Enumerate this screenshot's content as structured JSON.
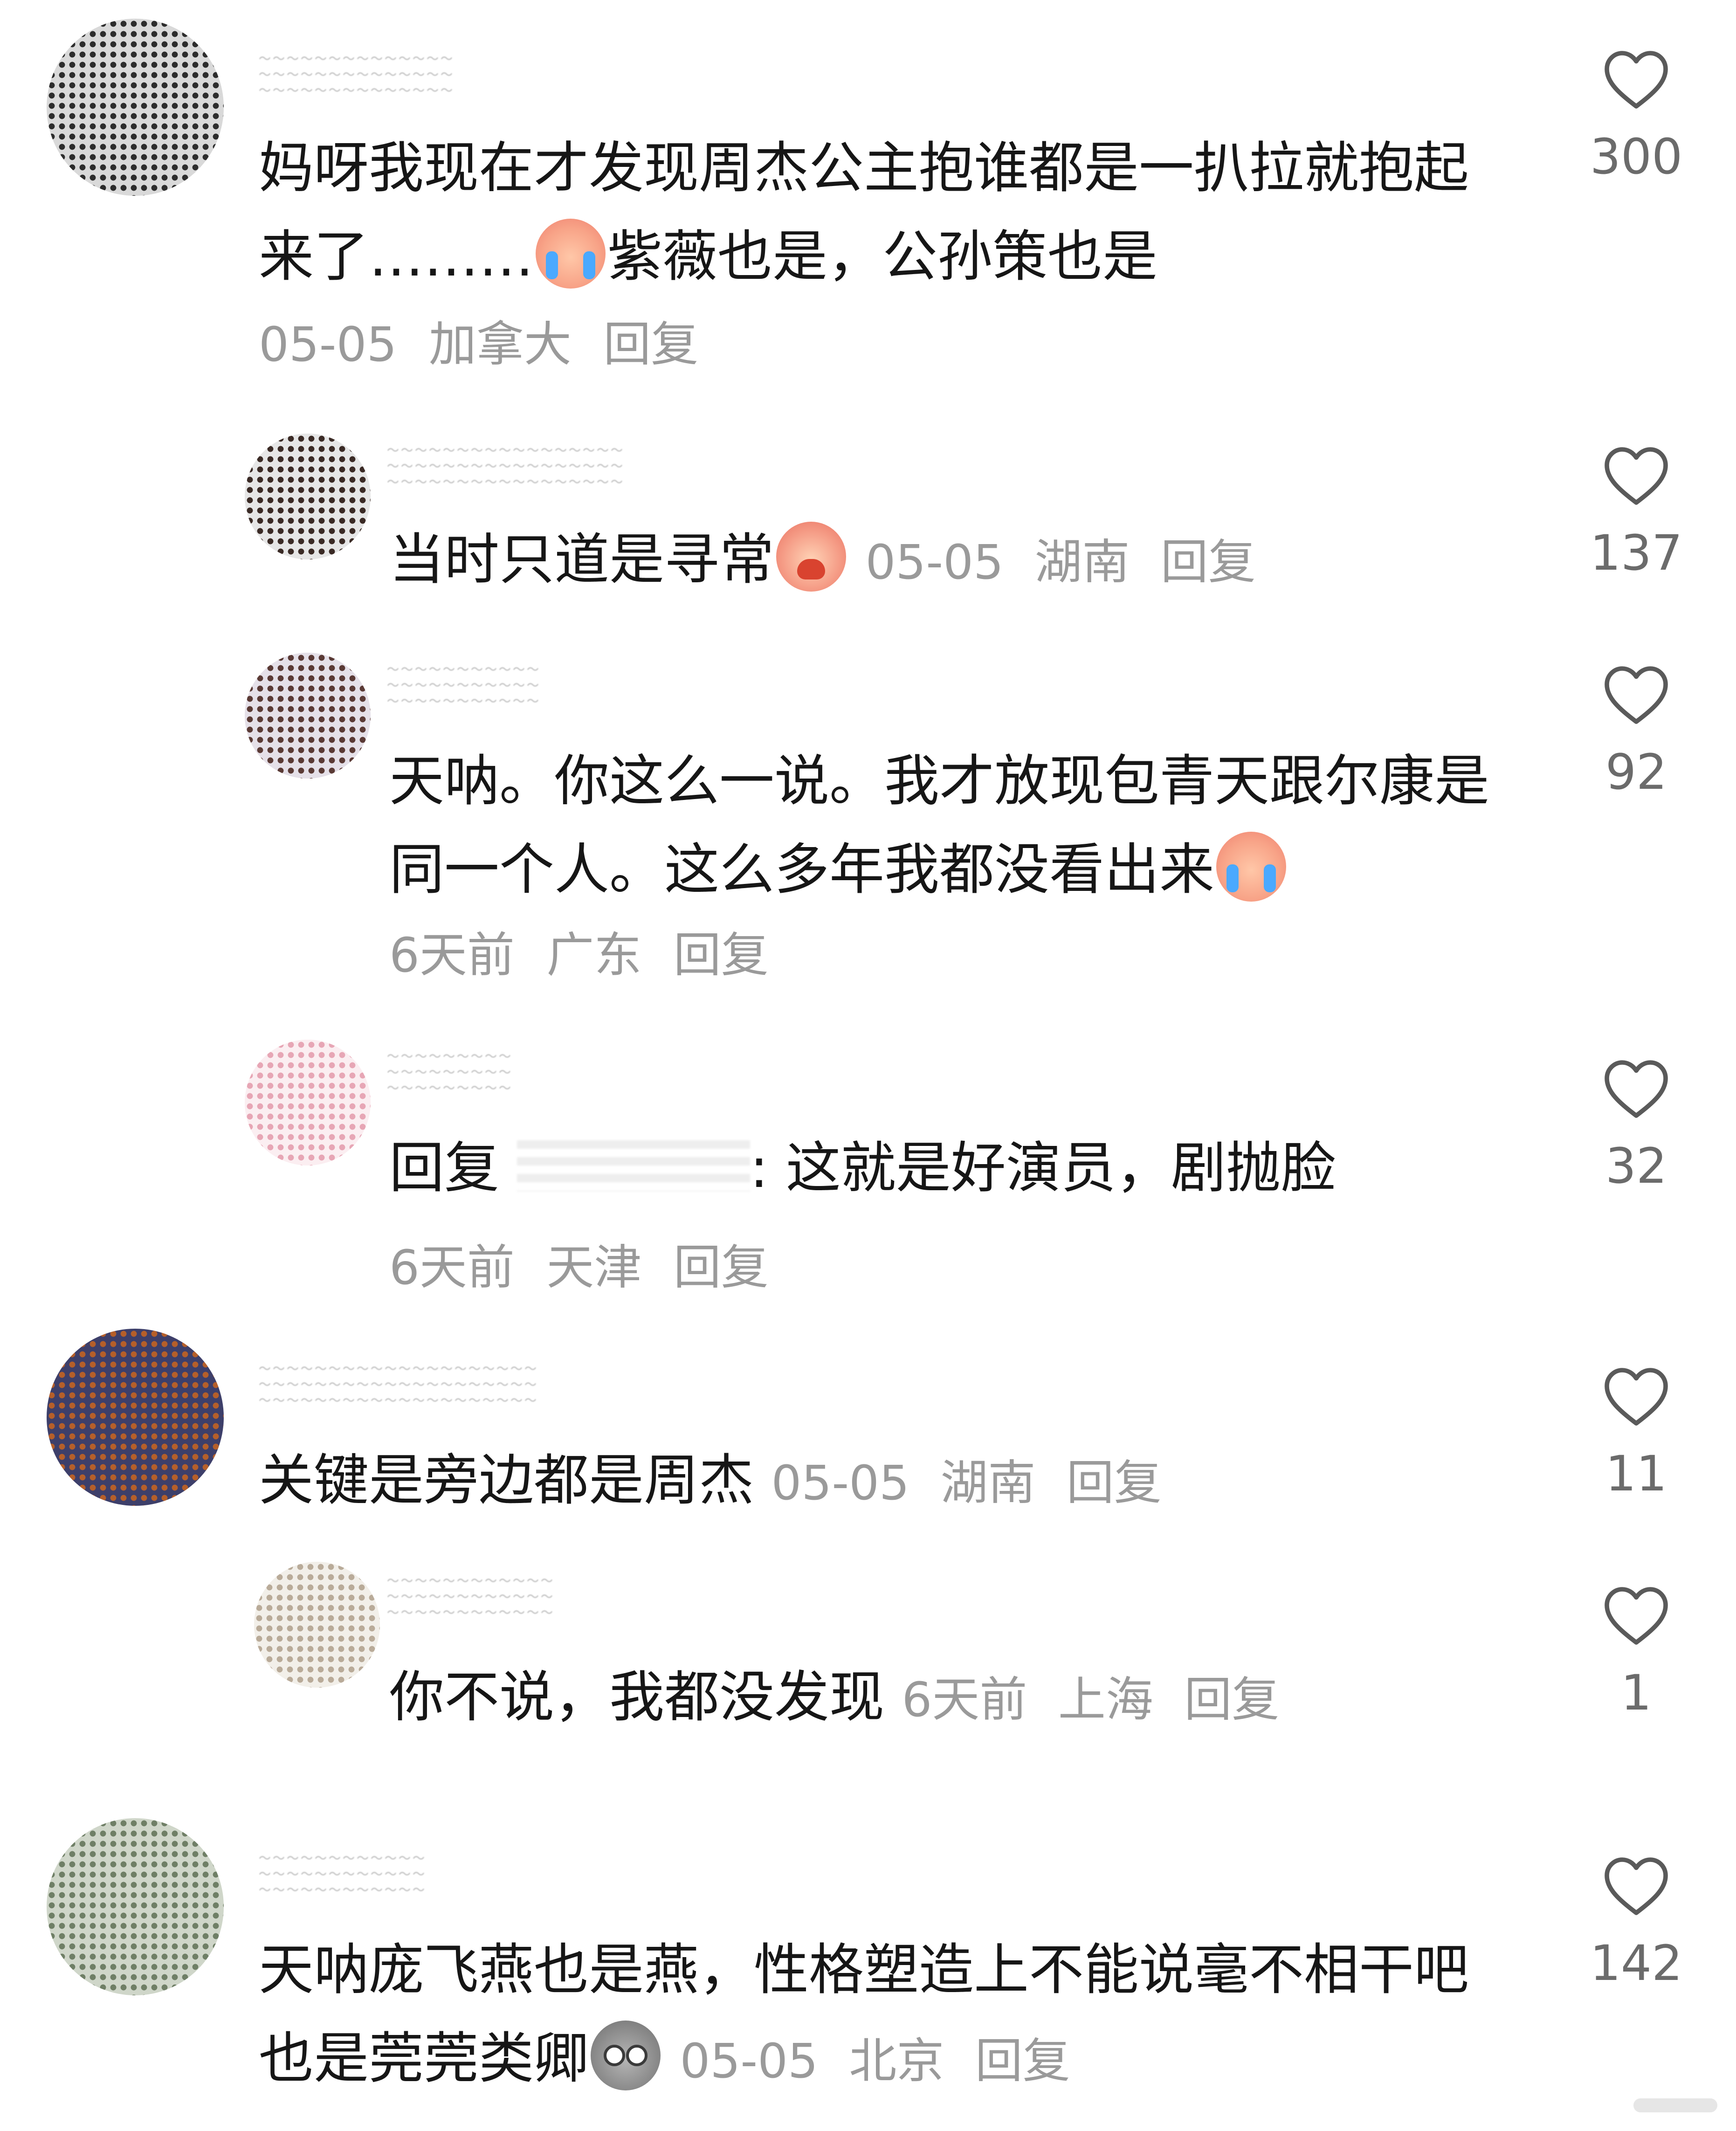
{
  "comments": [
    {
      "text": "妈呀我现在才发现周杰公主抱谁都是一扒拉就抱起",
      "text2": "来了………",
      "text3": "紫薇也是，公孙策也是",
      "date": "05-05",
      "location": "加拿大",
      "reply": "回复",
      "likes": "300",
      "avatar_color": "#2c2c2c"
    },
    {
      "text": "当时只道是寻常",
      "date": "05-05",
      "location": "湖南",
      "reply": "回复",
      "likes": "137",
      "avatar_color": "#3a2a25"
    },
    {
      "text": "天呐。你这么一说。我才放现包青天跟尔康是",
      "text2": "同一个人。这么多年我都没看出来",
      "date": "6天前",
      "location": "广东",
      "reply": "回复",
      "likes": "92",
      "avatar_color": "#5a3a35"
    },
    {
      "reply_prefix": "回复",
      "text": ": 这就是好演员，剧抛脸",
      "date": "6天前",
      "location": "天津",
      "reply": "回复",
      "likes": "32",
      "avatar_color": "#e7a6b5"
    },
    {
      "text": "关键是旁边都是周杰",
      "date": "05-05",
      "location": "湖南",
      "reply": "回复",
      "likes": "11",
      "avatar_color": "#b55f2a"
    },
    {
      "text": "你不说，我都没发现",
      "date": "6天前",
      "location": "上海",
      "reply": "回复",
      "likes": "1",
      "avatar_color": "#b9ab99"
    },
    {
      "text": "天呐庞飞燕也是燕，性格塑造上不能说毫不相干吧",
      "text2": "也是莞莞类卿",
      "date": "05-05",
      "location": "北京",
      "reply": "回复",
      "likes": "142",
      "avatar_color": "#6f7f66"
    }
  ],
  "icons": {
    "like": "heart-outline-icon",
    "emoji_cry": "crying-face-emoji",
    "emoji_tired": "tired-face-emoji",
    "emoji_gray": "pleading-face-emoji"
  }
}
